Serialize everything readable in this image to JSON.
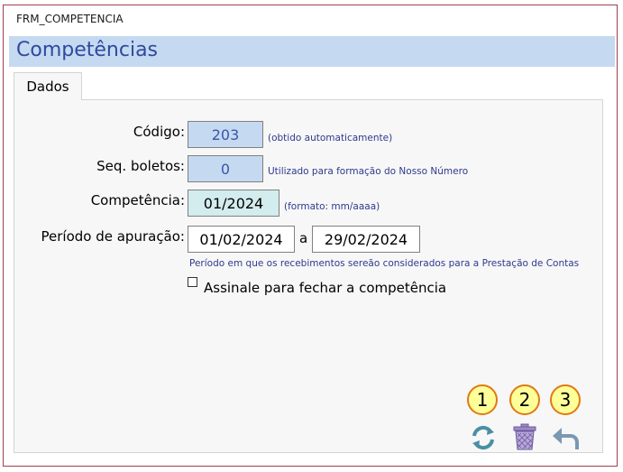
{
  "window": {
    "title": "FRM_COMPETENCIA"
  },
  "header": {
    "title": "Competências"
  },
  "tabs": [
    {
      "label": "Dados"
    }
  ],
  "form": {
    "codigo": {
      "label": "Código:",
      "value": "203",
      "hint": "(obtido automaticamente)"
    },
    "seq_boletos": {
      "label": "Seq. boletos:",
      "value": "0",
      "hint": "Utilizado para formação do Nosso Número"
    },
    "competencia": {
      "label": "Competência:",
      "value": "01/2024",
      "hint": "(formato: mm/aaaa)"
    },
    "periodo": {
      "label": "Período de apuração:",
      "start": "01/02/2024",
      "separator": "a",
      "end": "29/02/2024",
      "hint": "Período em que os recebimentos sereão considerados para a Prestação de Contas"
    },
    "fechar": {
      "label": "Assinale para fechar a competência",
      "checked": false
    }
  },
  "actions": [
    {
      "badge": "1",
      "icon": "refresh-icon"
    },
    {
      "badge": "2",
      "icon": "trash-icon"
    },
    {
      "badge": "3",
      "icon": "undo-icon"
    }
  ],
  "colors": {
    "header_band": "#c5d9f1",
    "header_text": "#2e4a9e",
    "badge_fill": "#ffff99",
    "badge_border": "#e07a10"
  }
}
